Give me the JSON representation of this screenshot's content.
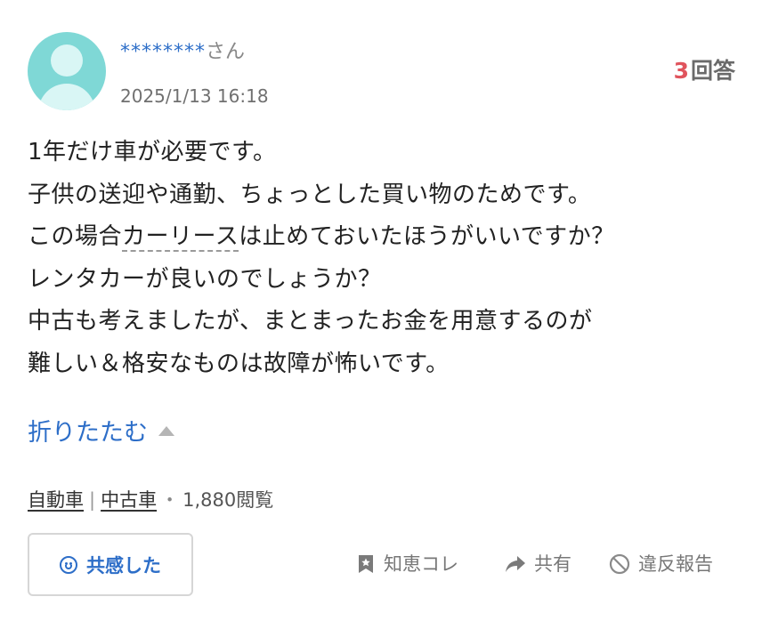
{
  "user": {
    "name_masked": "********",
    "name_suffix": "さん",
    "date": "2025/1/13 16:18"
  },
  "answers": {
    "count": "3",
    "label": "回答"
  },
  "question": {
    "line1": "1年だけ車が必要です。",
    "line2": "子供の送迎や通勤、ちょっとした買い物のためです。",
    "line3_before": "この場合",
    "line3_keyword": "カーリース",
    "line3_after": "は止めておいたほうがいいですか？",
    "line4": "レンタカーが良いのでしょうか？",
    "line5": "中古も考えましたが、まとまったお金を用意するのが",
    "line6": "難しい＆格安なものは故障が怖いです。"
  },
  "collapse_label": "折りたたむ",
  "tags": {
    "category1": "自動車",
    "category2": "中古車",
    "views": "1,880閲覧"
  },
  "actions": {
    "empathy": "共感した",
    "chiekore": "知恵コレ",
    "share": "共有",
    "report": "違反報告"
  },
  "colors": {
    "accent": "#2d6ec8",
    "answer_count": "#e0545d",
    "avatar": "#7fd8d6"
  },
  "icons": [
    "user-avatar",
    "collapse-triangle-icon",
    "smile-icon",
    "bookmark-star-icon",
    "share-arrow-icon",
    "report-block-icon"
  ]
}
